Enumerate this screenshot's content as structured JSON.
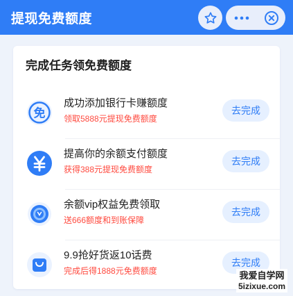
{
  "header": {
    "title": "提现免费额度",
    "star_icon": "star-icon",
    "more_icon": "more-dots-icon",
    "close_icon": "close-circle-icon",
    "bg_color": "#2f7df6"
  },
  "card": {
    "title": "完成任务领免费额度",
    "tasks": [
      {
        "name": "成功添加银行卡赚额度",
        "sub": "领取5888元提现免费额度",
        "button": "去完成",
        "icon": "free-badge-icon",
        "icon_glyph": "免"
      },
      {
        "name": "提高你的余额支付额度",
        "sub": "获得388元提现免费额度",
        "button": "去完成",
        "icon": "yuan-coin-icon",
        "icon_glyph": "¥"
      },
      {
        "name": "余额vip权益免费领取",
        "sub": "送666额度和到账保障",
        "button": "去完成",
        "icon": "vip-medal-icon",
        "icon_glyph": ""
      },
      {
        "name": "9.9抢好货返10话费",
        "sub": "完成后得1888元免费额度",
        "button": "去完成",
        "icon": "shopping-bag-icon",
        "icon_glyph": ""
      }
    ]
  },
  "watermark": {
    "cn": "我爱自学网",
    "en": "5izixue.com"
  },
  "colors": {
    "accent": "#2f7df6",
    "highlight_red": "#ff4a3f",
    "button_bg": "#e6f0ff"
  }
}
